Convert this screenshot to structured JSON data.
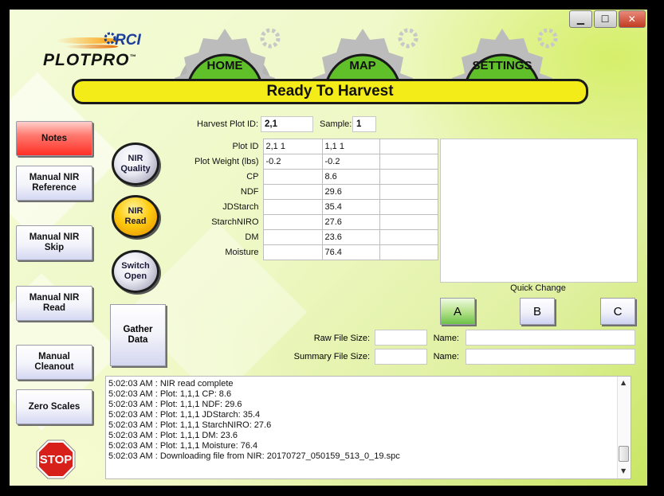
{
  "window": {
    "minimize": "▁",
    "maximize": "☐",
    "close": "✕"
  },
  "logo": {
    "brand": "RCI",
    "product": "PLOTPRO",
    "tm": "™"
  },
  "nav": {
    "home": "HOME",
    "map": "MAP",
    "settings": "SETTINGS"
  },
  "status": "Ready To Harvest",
  "sidebar": {
    "notes": "Notes",
    "manual_nir_reference": "Manual NIR\nReference",
    "manual_nir_skip": "Manual NIR\nSkip",
    "manual_nir_read": "Manual NIR\nRead",
    "manual_cleanout": "Manual\nCleanout",
    "zero_scales": "Zero Scales",
    "stop": "STOP"
  },
  "actions": {
    "nir_quality": "NIR\nQuality",
    "nir_read": "NIR\nRead",
    "switch_open": "Switch\nOpen",
    "gather_data": "Gather\nData"
  },
  "harvest": {
    "plot_id_label": "Harvest Plot ID:",
    "plot_id_value": "2,1",
    "sample_label": "Sample:",
    "sample_value": "1"
  },
  "grid": {
    "rows": [
      {
        "label": "Plot ID",
        "c1": "2,1  1",
        "c2": "1,1  1",
        "c3": ""
      },
      {
        "label": "Plot Weight (lbs)",
        "c1": "-0.2",
        "c2": "-0.2",
        "c3": ""
      },
      {
        "label": "CP",
        "c1": "",
        "c2": "8.6",
        "c3": ""
      },
      {
        "label": "NDF",
        "c1": "",
        "c2": "29.6",
        "c3": ""
      },
      {
        "label": "JDStarch",
        "c1": "",
        "c2": "35.4",
        "c3": ""
      },
      {
        "label": "StarchNIRO",
        "c1": "",
        "c2": "27.6",
        "c3": ""
      },
      {
        "label": "DM",
        "c1": "",
        "c2": "23.6",
        "c3": ""
      },
      {
        "label": "Moisture",
        "c1": "",
        "c2": "76.4",
        "c3": ""
      }
    ]
  },
  "quick_change": {
    "label": "Quick Change",
    "a": "A",
    "b": "B",
    "c": "C"
  },
  "files": {
    "raw_label": "Raw File  Size:",
    "summary_label": "Summary File  Size:",
    "name_label": "Name:",
    "raw_size": "",
    "raw_name": "",
    "summary_size": "",
    "summary_name": ""
  },
  "log": {
    "lines": [
      "5:02:03 AM : NIR read complete",
      "5:02:03 AM : Plot: 1,1,1 CP: 8.6",
      "5:02:03 AM : Plot: 1,1,1 NDF: 29.6",
      "5:02:03 AM : Plot: 1,1,1 JDStarch: 35.4",
      "5:02:03 AM : Plot: 1,1,1 StarchNIRO: 27.6",
      "5:02:03 AM : Plot: 1,1,1 DM: 23.6",
      "5:02:03 AM : Plot: 1,1,1 Moisture: 76.4",
      "5:02:03 AM : Downloading file from NIR: 20170727_050159_513_0_19.spc"
    ],
    "scroll_up": "▲",
    "scroll_down": "▼"
  },
  "colors": {
    "status_bar": "#f3ec18",
    "nav_dome": "#5fc02a",
    "notes_button": "#ff2f24",
    "nir_read_button": "#ffcc10",
    "stop_sign": "#d8201a"
  }
}
